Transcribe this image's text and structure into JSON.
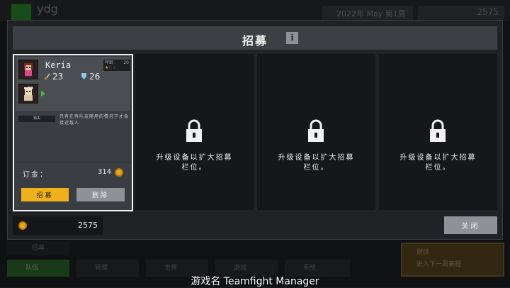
{
  "background": {
    "team_name": "ydg",
    "date": "2022年 May 第1周",
    "coins": "2575",
    "nav_label": "招募",
    "nav": [
      "队伍",
      "管理",
      "世界",
      "游戏",
      "系统"
    ],
    "continue_title": "继续",
    "continue_sub": "进入下一周赛程"
  },
  "modal": {
    "title": "招募",
    "info_icon": "i",
    "candidate": {
      "name": "Keria",
      "attack": "23",
      "defense": "26",
      "age_label": "年龄",
      "age": "20",
      "level": "10",
      "tag": "锁夫",
      "description": "只有在有队友随用的情况下才会接近敌人",
      "fee_label": "订金：",
      "fee_value": "314",
      "recruit_label": "招募",
      "delete_label": "删除"
    },
    "locked_slots": [
      {
        "text_line1": "升级设备以扩大招募",
        "text_line2": "栏位。"
      },
      {
        "text_line1": "升级设备以扩大招募",
        "text_line2": "栏位。"
      },
      {
        "text_line1": "升级设备以扩大招募",
        "text_line2": "栏位。"
      }
    ],
    "coins": "2575",
    "close_label": "关闭"
  },
  "caption": "游戏名 Teamfight Manager",
  "colors": {
    "accent": "#f0b21c",
    "panel": "#202226",
    "slot": "#15171a"
  },
  "icons": [
    "lock-icon",
    "info-icon",
    "coin-icon",
    "sword-icon",
    "shield-icon"
  ]
}
